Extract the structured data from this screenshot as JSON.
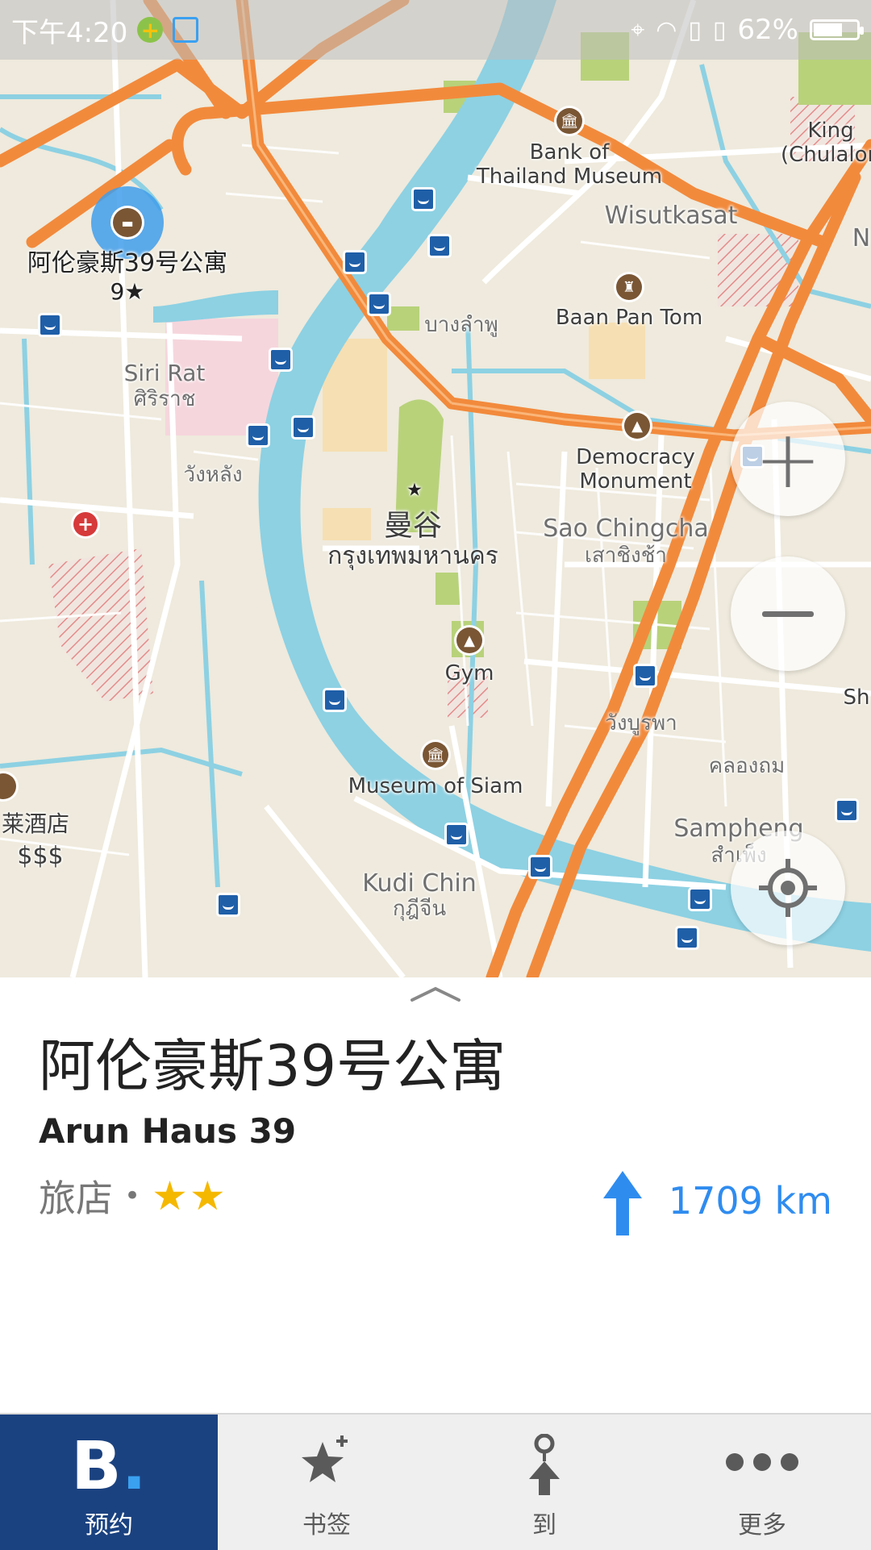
{
  "status_bar": {
    "time": "下午4:20",
    "battery": "62%"
  },
  "map": {
    "selected_place_label": "阿伦豪斯39号公寓",
    "selected_place_rating": "9★",
    "labels": {
      "bank_museum": "Bank of\nThailand Museum",
      "wisutkasat": "Wisutkasat",
      "king": "King\n(Chulalon",
      "n": "N",
      "bang_lamphu_th": "บางลำพู",
      "baan_pan_tom": "Baan Pan Tom",
      "siri_rat": "Siri Rat",
      "siri_rat_th": "ศิริราช",
      "wang_lang_th": "วังหลัง",
      "democracy": "Democracy\nMonument",
      "bangkok_zh": "曼谷",
      "bangkok_th": "กรุงเทพมหานคร",
      "sao_chingcha": "Sao Chingcha",
      "sao_chingcha_th": "เสาชิงช้า",
      "gym": "Gym",
      "wang_burapha_th": "วังบูรพา",
      "sh": "Sh",
      "museum_siam": "Museum of Siam",
      "khlong_thom_th": "คลองถม",
      "hotel_partial": "莱酒店",
      "price": "$$$",
      "sampheng": "Sampheng",
      "sampheng_th": "สำเพ็ง",
      "kudi_chin": "Kudi Chin",
      "kudi_chin_th": "กุฎีจีน"
    }
  },
  "place": {
    "name_zh": "阿伦豪斯39号公寓",
    "name_en": "Arun Haus 39",
    "category": "旅店",
    "separator": "•",
    "stars": "★★",
    "distance": "1709 km"
  },
  "tabs": [
    {
      "label": "预约",
      "icon": "booking-logo-icon"
    },
    {
      "label": "书签",
      "icon": "bookmark-star-icon"
    },
    {
      "label": "到",
      "icon": "route-to-icon"
    },
    {
      "label": "更多",
      "icon": "more-dots-icon"
    }
  ],
  "colors": {
    "land": "#efeadd",
    "river": "#8dd1e3",
    "major_road": "#f28a3c",
    "park": "#b8d27a",
    "tab_active": "#1b4280",
    "accent_blue": "#2f8cef",
    "star": "#f5b800"
  }
}
